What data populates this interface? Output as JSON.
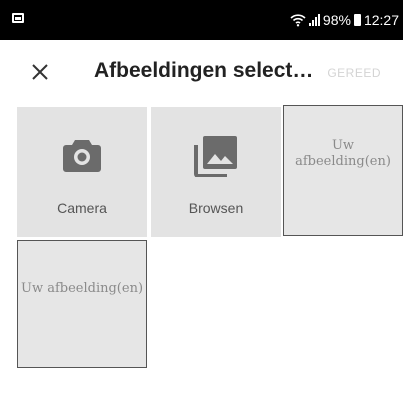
{
  "status_bar": {
    "battery": "98%",
    "time": "12:27"
  },
  "app_bar": {
    "title": "Afbeeldingen select…",
    "done_label": "GEREED"
  },
  "tiles": [
    {
      "label": "Camera",
      "icon": "camera-icon"
    },
    {
      "label": "Browsen",
      "icon": "gallery-icon"
    },
    {
      "label": "Uw afbeelding(en)"
    },
    {
      "label": "Uw afbeelding(en)"
    }
  ],
  "colors": {
    "status_bar_bg": "#000000",
    "tile_bg": "#e3e3e3",
    "icon_color": "#6b6b6b",
    "done_disabled": "#d4d4d4"
  }
}
